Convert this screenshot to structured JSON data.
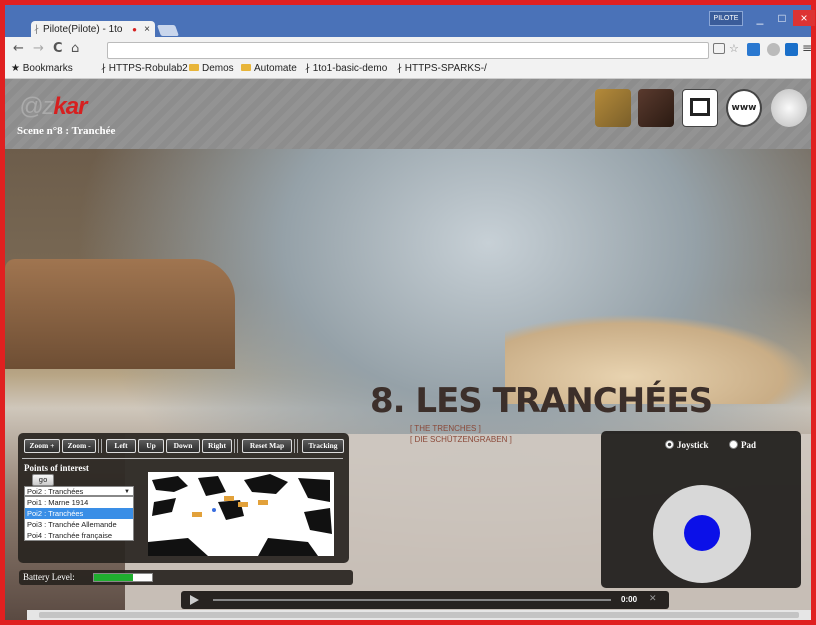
{
  "window": {
    "tab_title": "Pilote(Pilote) - 1to",
    "tab_close": "×",
    "profile_label": "PILOTE",
    "min": "_",
    "max": "□",
    "close": "×"
  },
  "toolbar": {
    "back": "←",
    "forward": "→",
    "reload": "C",
    "home": "⌂",
    "menu": "≡"
  },
  "bookmarks": [
    {
      "label": "Bookmarks",
      "icon": "star-icon"
    },
    {
      "label": "HTTPS-Robulab2",
      "icon": "robot-icon"
    },
    {
      "label": "Demos",
      "icon": "folder-icon"
    },
    {
      "label": "Automate",
      "icon": "folder-icon"
    },
    {
      "label": "1to1-basic-demo",
      "icon": "robot-icon"
    },
    {
      "label": "HTTPS-SPARKS-/",
      "icon": "robot-icon"
    }
  ],
  "header": {
    "logo_at": "@",
    "logo_z": "z",
    "logo_kar": "kar",
    "scene_title": "Scene n°8 : Tranchée"
  },
  "exhibit": {
    "title": "8. LES TRANCHÉES",
    "subtitle_en": "[ THE TRENCHES ]",
    "subtitle_de": "[ DIE SCHÜTZENGRABEN ]"
  },
  "controls": {
    "zoom_in": "Zoom +",
    "zoom_out": "Zoom -",
    "left": "Left",
    "up": "Up",
    "down": "Down",
    "right": "Right",
    "reset_map": "Reset Map",
    "tracking": "Tracking",
    "points_label": "Points of interest",
    "go": "go",
    "selected_poi": "Poi2 : Tranchées",
    "poi_options": [
      "Poi1 : Marne 1914",
      "Poi2 : Tranchées",
      "Poi3 : Tranchée Allemande",
      "Poi4 : Tranchée française"
    ],
    "selected_index": 1
  },
  "battery": {
    "label": "Battery Level:",
    "level": 0.68,
    "color": "#1fae2f"
  },
  "joystick": {
    "mode_joystick": "Joystick",
    "mode_pad": "Pad",
    "selected_mode": "Joystick",
    "knob_color": "#0b10e8"
  },
  "video": {
    "time": "0:00"
  },
  "colors": {
    "accent_red": "#d62020",
    "frame_border": "#e02020",
    "selection_blue": "#3a8ee6"
  }
}
